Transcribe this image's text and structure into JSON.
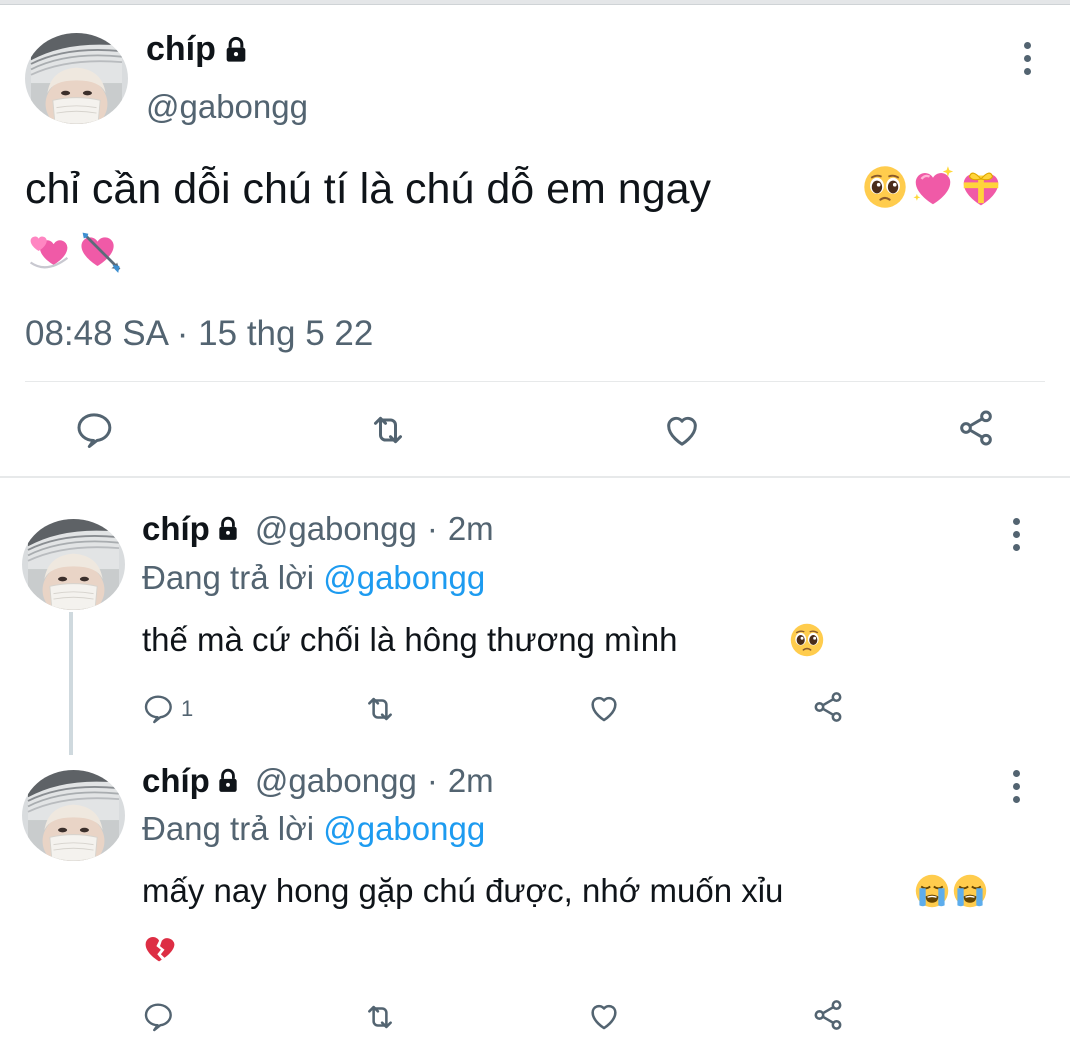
{
  "main_tweet": {
    "display_name": "chíp",
    "handle": "@gabongg",
    "text": "chỉ cần dỗi chú tí là chú dỗ em ngay",
    "emojis_line1": [
      "pleading-face",
      "sparkling-heart",
      "heart-with-ribbon"
    ],
    "emojis_line2": [
      "revolving-hearts",
      "heart-with-arrow"
    ],
    "timestamp": "08:48 SA · 15 thg 5 22",
    "actions": [
      "reply",
      "retweet",
      "like",
      "share"
    ]
  },
  "replies": [
    {
      "display_name": "chíp",
      "handle": "@gabongg",
      "separator": "·",
      "time": "2m",
      "replying_prefix": "Đang trả lời",
      "replying_to": "@gabongg",
      "text": "thế mà cứ chối là hông thương mình",
      "emojis": [
        "pleading-face"
      ],
      "reply_count": "1"
    },
    {
      "display_name": "chíp",
      "handle": "@gabongg",
      "separator": "·",
      "time": "2m",
      "replying_prefix": "Đang trả lời",
      "replying_to": "@gabongg",
      "text": "mấy nay hong gặp chú được, nhớ muốn xỉu",
      "emojis": [
        "loudly-crying-face",
        "loudly-crying-face"
      ],
      "emojis_line2": [
        "broken-heart"
      ],
      "reply_count": ""
    }
  ],
  "colors": {
    "text_primary": "#0f1419",
    "text_secondary": "#536471",
    "mention": "#1d9bf0",
    "divider": "#e7e9ea"
  }
}
